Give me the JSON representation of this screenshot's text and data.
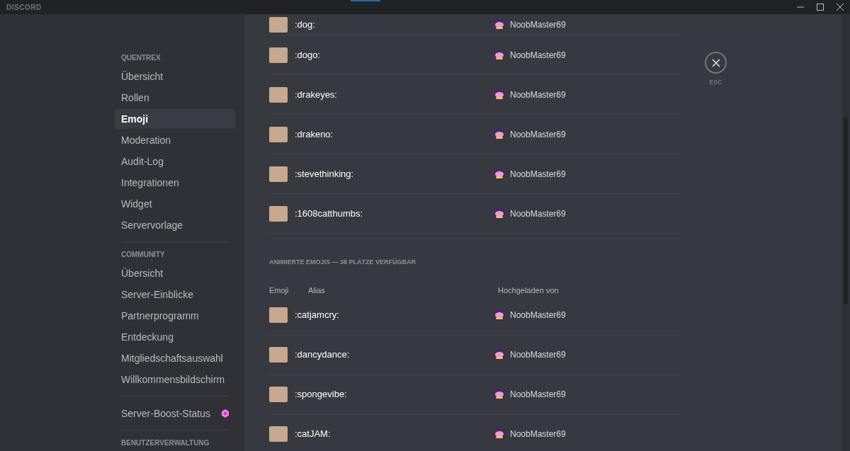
{
  "window": {
    "title": "DISCORD"
  },
  "sidebar": {
    "sections": [
      {
        "header": "QUENTREX",
        "items": [
          {
            "label": "Übersicht",
            "selected": false
          },
          {
            "label": "Rollen",
            "selected": false
          },
          {
            "label": "Emoji",
            "selected": true
          },
          {
            "label": "Moderation",
            "selected": false
          },
          {
            "label": "Audit-Log",
            "selected": false
          },
          {
            "label": "Integrationen",
            "selected": false
          },
          {
            "label": "Widget",
            "selected": false
          },
          {
            "label": "Servervorlage",
            "selected": false
          }
        ]
      },
      {
        "header": "COMMUNITY",
        "items": [
          {
            "label": "Übersicht",
            "selected": false
          },
          {
            "label": "Server-Einblicke",
            "selected": false
          },
          {
            "label": "Partnerprogramm",
            "selected": false
          },
          {
            "label": "Entdeckung",
            "selected": false
          },
          {
            "label": "Mitgliedschaftsauswahl",
            "selected": false
          },
          {
            "label": "Willkommensbildschirm",
            "selected": false
          }
        ]
      },
      {
        "items": [
          {
            "label": "Server-Boost-Status",
            "selected": false,
            "kind": "boost"
          }
        ]
      },
      {
        "header": "BENUTZERVERWALTUNG"
      }
    ]
  },
  "static_emojis": [
    {
      "alias": ":dog:",
      "uploader": "NoobMaster69"
    },
    {
      "alias": ":dogo:",
      "uploader": "NoobMaster69"
    },
    {
      "alias": ":drakeyes:",
      "uploader": "NoobMaster69"
    },
    {
      "alias": ":drakeno:",
      "uploader": "NoobMaster69"
    },
    {
      "alias": ":stevethinking:",
      "uploader": "NoobMaster69"
    },
    {
      "alias": ":1608catthumbs:",
      "uploader": "NoobMaster69"
    }
  ],
  "animated_section": {
    "title": "ANIMIERTE EMOJIS — 38 PLÄTZE VERFÜGBAR",
    "columns": [
      "Emoji",
      "Alias",
      "Hochgeladen von"
    ],
    "rows": [
      {
        "alias": ":catjamcry:",
        "uploader": "NoobMaster69"
      },
      {
        "alias": ":dancydance:",
        "uploader": "NoobMaster69"
      },
      {
        "alias": ":spongevibe:",
        "uploader": "NoobMaster69"
      },
      {
        "alias": ":catJAM:",
        "uploader": "NoobMaster69"
      }
    ]
  },
  "close_button": {
    "label": "ESC"
  }
}
